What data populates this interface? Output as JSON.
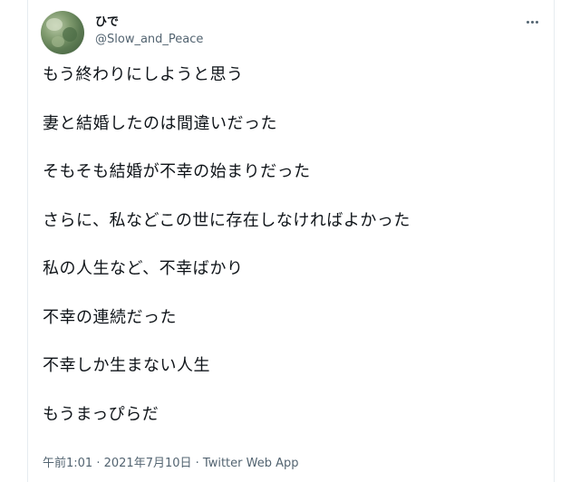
{
  "user": {
    "display_name": "ひで",
    "handle": "@Slow_and_Peace",
    "avatar_icon": "forest-avatar-icon"
  },
  "menu": {
    "icon": "more-horizontal-icon"
  },
  "tweet": {
    "lines": [
      "もう終わりにしようと思う",
      "妻と結婚したのは間違いだった",
      "そもそも結婚が不幸の始まりだった",
      "さらに、私などこの世に存在しなければよかった",
      "私の人生など、不幸ばかり",
      "不幸の連続だった",
      "不幸しか生まない人生",
      "もうまっぴらだ"
    ]
  },
  "meta": {
    "time": "午前1:01",
    "separator": " · ",
    "date": "2021年7月10日",
    "app": "Twitter Web App"
  }
}
